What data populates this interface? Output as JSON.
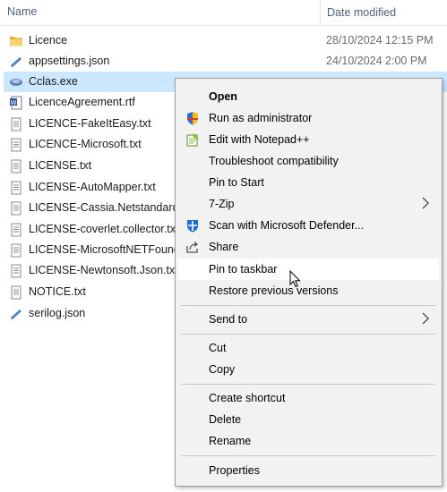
{
  "columns": {
    "name": "Name",
    "date_modified": "Date modified"
  },
  "files": [
    {
      "name": "Licence",
      "date": "28/10/2024 12:15 PM",
      "icon": "folder-icon"
    },
    {
      "name": "appsettings.json",
      "date": "24/10/2024 2:00 PM",
      "icon": "json-file-icon"
    },
    {
      "name": "Cclas.exe",
      "date": "",
      "icon": "exe-file-icon"
    },
    {
      "name": "LicenceAgreement.rtf",
      "date": "",
      "icon": "word-doc-icon"
    },
    {
      "name": "LICENCE-FakeItEasy.txt",
      "date": "",
      "icon": "text-file-icon"
    },
    {
      "name": "LICENCE-Microsoft.txt",
      "date": "",
      "icon": "text-file-icon"
    },
    {
      "name": "LICENSE.txt",
      "date": "",
      "icon": "text-file-icon"
    },
    {
      "name": "LICENSE-AutoMapper.txt",
      "date": "",
      "icon": "text-file-icon"
    },
    {
      "name": "LICENSE-Cassia.Netstandard.",
      "date": "",
      "icon": "text-file-icon"
    },
    {
      "name": "LICENSE-coverlet.collector.tx",
      "date": "",
      "icon": "text-file-icon"
    },
    {
      "name": "LICENSE-MicrosoftNETFound",
      "date": "",
      "icon": "text-file-icon"
    },
    {
      "name": "LICENSE-Newtonsoft.Json.txt",
      "date": "",
      "icon": "text-file-icon"
    },
    {
      "name": "NOTICE.txt",
      "date": "",
      "icon": "text-file-icon"
    },
    {
      "name": "serilog.json",
      "date": "",
      "icon": "json-file-icon"
    }
  ],
  "menu": {
    "open": "Open",
    "run_as_admin": "Run as administrator",
    "edit_notepad": "Edit with Notepad++",
    "troubleshoot": "Troubleshoot compatibility",
    "pin_start": "Pin to Start",
    "zip": "7-Zip",
    "scan_defender": "Scan with Microsoft Defender...",
    "share": "Share",
    "pin_taskbar": "Pin to taskbar",
    "restore_versions": "Restore previous versions",
    "send_to": "Send to",
    "cut": "Cut",
    "copy": "Copy",
    "create_shortcut": "Create shortcut",
    "delete": "Delete",
    "rename": "Rename",
    "properties": "Properties"
  },
  "colors": {
    "selection": "#cce8ff",
    "menu_bg": "#f2f2f2",
    "menu_hover": "#ffffff"
  }
}
